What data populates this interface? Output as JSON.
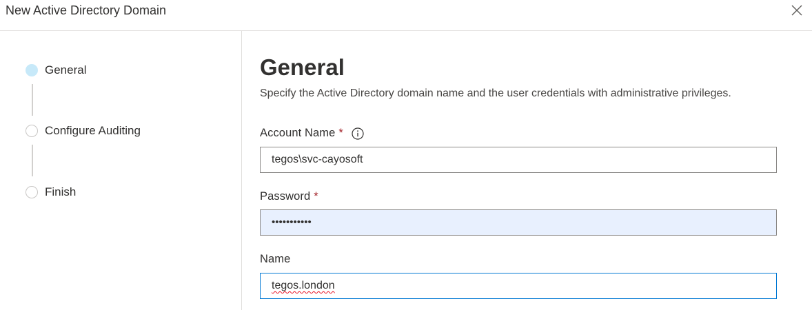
{
  "dialog": {
    "title": "New Active Directory Domain",
    "close_icon": "close-icon"
  },
  "steps": [
    {
      "label": "General",
      "state": "active"
    },
    {
      "label": "Configure Auditing",
      "state": "pending"
    },
    {
      "label": "Finish",
      "state": "pending"
    }
  ],
  "main": {
    "heading": "General",
    "description": "Specify the Active Directory domain name and the user credentials with administrative privileges."
  },
  "fields": {
    "account_name": {
      "label": "Account Name",
      "required_mark": "*",
      "info_icon": "info-icon",
      "value": "tegos\\svc-cayosoft"
    },
    "password": {
      "label": "Password",
      "required_mark": "*",
      "value": "•••••••••••"
    },
    "name": {
      "label": "Name",
      "value": "tegos.london"
    }
  },
  "colors": {
    "active_step": "#c7e9f9",
    "required": "#a4262c",
    "focus_border": "#0078d4",
    "autofill_bg": "#e8f0fe"
  }
}
